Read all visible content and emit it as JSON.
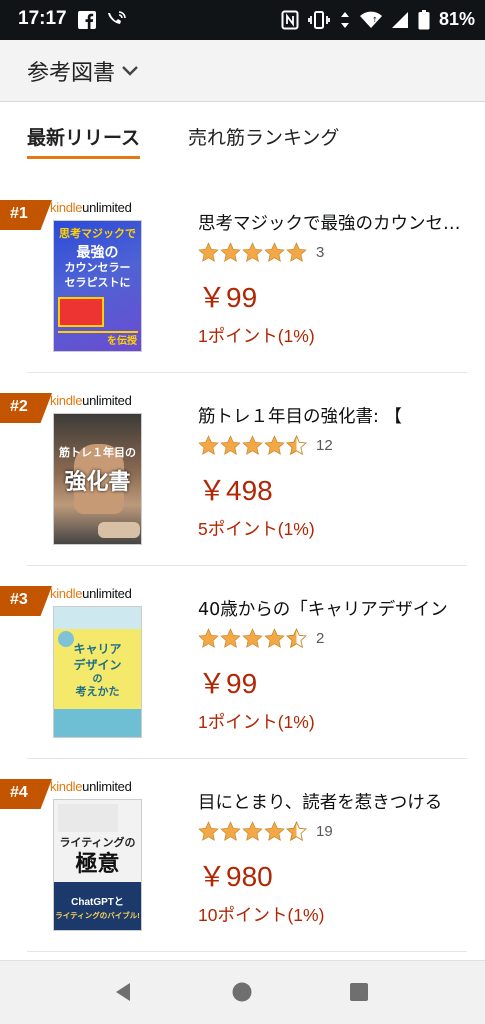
{
  "status_bar": {
    "time": "17:17",
    "battery": "81%",
    "icons": [
      "facebook-icon",
      "wifi-calling-icon",
      "nfc-icon",
      "vibrate-icon",
      "data-arrows-icon",
      "wifi-icon",
      "signal-icon",
      "battery-icon"
    ]
  },
  "header": {
    "title": "参考図書"
  },
  "tabs": [
    {
      "label": "最新リリース",
      "active": true
    },
    {
      "label": "売れ筋ランキング",
      "active": false
    }
  ],
  "items": [
    {
      "rank": "#1",
      "badge": "kindleunlimited",
      "title": "思考マジックで最強のカウンセラー",
      "rating": 5,
      "rating_count": "3",
      "price": "￥99",
      "points": "1ポイント(1%)",
      "cover_lines": [
        "思考マジックで",
        "最強の",
        "カウンセラー",
        "セラピストに",
        "を伝授"
      ]
    },
    {
      "rank": "#2",
      "badge": "kindleunlimited",
      "title": "筋トレ１年目の強化書: 【",
      "rating": 4.5,
      "rating_count": "12",
      "price": "￥498",
      "points": "5ポイント(1%)",
      "cover_lines": [
        "筋トレ１年目の",
        "強化書"
      ]
    },
    {
      "rank": "#3",
      "badge": "kindleunlimited",
      "title": "40歳からの「キャリアデザイン",
      "rating": 4.5,
      "rating_count": "2",
      "price": "￥99",
      "points": "1ポイント(1%)",
      "cover_lines": [
        "キャリア",
        "デザイン",
        "の",
        "考えかた"
      ]
    },
    {
      "rank": "#4",
      "badge": "kindleunlimited",
      "title": "目にとまり、読者を惹きつける",
      "rating": 4.5,
      "rating_count": "19",
      "price": "￥980",
      "points": "10ポイント(1%)",
      "cover_lines": [
        "ライティングの",
        "極意",
        "ChatGPTと",
        "ライティングのバイブル!"
      ]
    }
  ],
  "colors": {
    "accent": "#e47911",
    "rank_badge": "#c45500",
    "price": "#b12704",
    "star": "#f3a847"
  }
}
